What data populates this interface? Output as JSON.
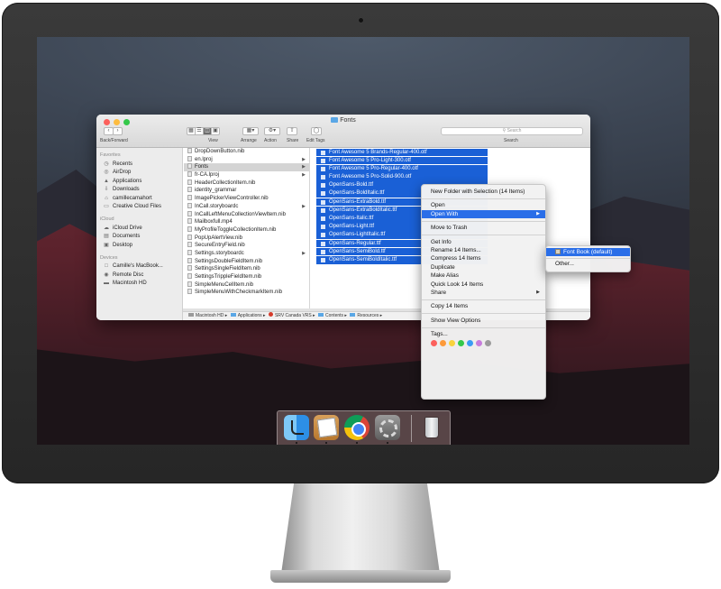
{
  "window": {
    "title": "Fonts",
    "toolbar": {
      "back_forward_label": "Back/Forward",
      "view_label": "View",
      "arrange_label": "Arrange",
      "action_label": "Action",
      "share_label": "Share",
      "edit_tags_label": "Edit Tags",
      "search_placeholder": "Search",
      "search_label": "Search"
    }
  },
  "sidebar": {
    "favorites_heading": "Favorites",
    "favorites": [
      {
        "label": "Recents",
        "icon": "clock-icon"
      },
      {
        "label": "AirDrop",
        "icon": "airdrop-icon"
      },
      {
        "label": "Applications",
        "icon": "applications-icon"
      },
      {
        "label": "Downloads",
        "icon": "download-icon"
      },
      {
        "label": "camillecamahort",
        "icon": "home-icon"
      },
      {
        "label": "Creative Cloud Files",
        "icon": "folder-icon"
      }
    ],
    "icloud_heading": "iCloud",
    "icloud": [
      {
        "label": "iCloud Drive",
        "icon": "cloud-icon"
      },
      {
        "label": "Documents",
        "icon": "document-icon"
      },
      {
        "label": "Desktop",
        "icon": "desktop-icon"
      }
    ],
    "devices_heading": "Devices",
    "devices": [
      {
        "label": "Camille's MacBook...",
        "icon": "laptop-icon"
      },
      {
        "label": "Remote Disc",
        "icon": "disc-icon"
      },
      {
        "label": "Macintosh HD",
        "icon": "drive-icon"
      }
    ]
  },
  "column1": [
    {
      "label": "DropDownButton.nib",
      "arrow": false
    },
    {
      "label": "en.lproj",
      "arrow": true
    },
    {
      "label": "Fonts",
      "arrow": true,
      "selected": true
    },
    {
      "label": "fr-CA.lproj",
      "arrow": true
    },
    {
      "label": "HeaderCollectionItem.nib",
      "arrow": false
    },
    {
      "label": "identity_grammar",
      "arrow": false
    },
    {
      "label": "ImagePickerViewController.nib",
      "arrow": false
    },
    {
      "label": "InCall.storyboardc",
      "arrow": true
    },
    {
      "label": "InCallLeftMenuCollectionViewItem.nib",
      "arrow": false
    },
    {
      "label": "Mailboxfull.mp4",
      "arrow": false
    },
    {
      "label": "MyProfileToggleCollectionItem.nib",
      "arrow": false
    },
    {
      "label": "PopUpAlertView.nib",
      "arrow": false
    },
    {
      "label": "SecureEntryField.nib",
      "arrow": false
    },
    {
      "label": "Settings.storyboardc",
      "arrow": true
    },
    {
      "label": "SettingsDoubleFieldItem.nib",
      "arrow": false
    },
    {
      "label": "SettingsSingleFieldItem.nib",
      "arrow": false
    },
    {
      "label": "SettingsTrippleFieldItem.nib",
      "arrow": false
    },
    {
      "label": "SimpleMenuCellItem.nib",
      "arrow": false
    },
    {
      "label": "SimpleMenuWithCheckmarkItem.nib",
      "arrow": false
    }
  ],
  "column2": [
    "Font Awesome 5 Brands-Regular-400.otf",
    "Font Awesome 5 Pro-Light-300.otf",
    "Font Awesome 5 Pro-Regular-400.otf",
    "Font Awesome 5 Pro-Solid-900.otf",
    "OpenSans-Bold.ttf",
    "OpenSans-BoldItalic.ttf",
    "OpenSans-ExtraBold.ttf",
    "OpenSans-ExtraBoldItalic.ttf",
    "OpenSans-Italic.ttf",
    "OpenSans-Light.ttf",
    "OpenSans-LightItalic.ttf",
    "OpenSans-Regular.ttf",
    "OpenSans-SemiBold.ttf",
    "OpenSans-SemiBoldItalic.ttf"
  ],
  "pathbar": [
    "Macintosh HD",
    "Applications",
    "SRV Canada VRS",
    "Contents",
    "Resources"
  ],
  "context_menu": {
    "new_folder": "New Folder with Selection (14 Items)",
    "open": "Open",
    "open_with": "Open With",
    "move_to_trash": "Move to Trash",
    "get_info": "Get Info",
    "rename": "Rename 14 Items...",
    "compress": "Compress 14 Items",
    "duplicate": "Duplicate",
    "make_alias": "Make Alias",
    "quick_look": "Quick Look 14 Items",
    "share": "Share",
    "copy": "Copy 14 Items",
    "show_view_options": "Show View Options",
    "tags": "Tags...",
    "tag_colors": [
      "#fc605c",
      "#fd9a3a",
      "#f8d23c",
      "#34c84a",
      "#3a9bf4",
      "#c77ddc",
      "#9b9b9b"
    ]
  },
  "submenu": {
    "font_book": "Font Book (default)",
    "other": "Other..."
  },
  "dock": [
    {
      "name": "finder-app",
      "running": true
    },
    {
      "name": "preview-app",
      "running": true
    },
    {
      "name": "chrome-app",
      "running": true
    },
    {
      "name": "system-preferences-app",
      "running": true
    },
    {
      "name": "trash",
      "running": false
    }
  ]
}
